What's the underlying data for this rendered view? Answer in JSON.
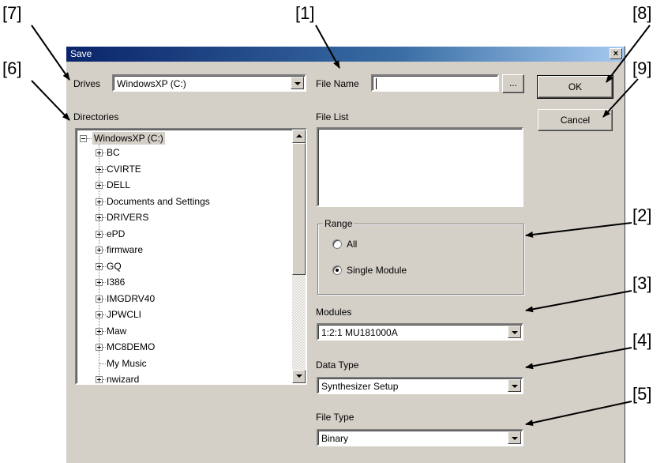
{
  "callouts": [
    "[7]",
    "[1]",
    "[8]",
    "[6]",
    "[9]",
    "[2]",
    "[3]",
    "[4]",
    "[5]"
  ],
  "dialog": {
    "title": "Save",
    "close_glyph": "×"
  },
  "drives": {
    "label": "Drives",
    "value": "WindowsXP (C:)"
  },
  "directories": {
    "label": "Directories",
    "root": "WindowsXP (C:)",
    "items": [
      "BC",
      "CVIRTE",
      "DELL",
      "Documents and Settings",
      "DRIVERS",
      "ePD",
      "firmware",
      "GQ",
      "I386",
      "IMGDRV40",
      "JPWCLI",
      "Maw",
      "MC8DEMO",
      "My Music",
      "nwizard"
    ]
  },
  "file_name": {
    "label": "File Name",
    "value": "",
    "browse_label": "..."
  },
  "file_list": {
    "label": "File List"
  },
  "range": {
    "label": "Range",
    "options": [
      "All",
      "Single Module"
    ],
    "selected": "Single Module"
  },
  "modules": {
    "label": "Modules",
    "value": "1:2:1 MU181000A"
  },
  "data_type": {
    "label": "Data Type",
    "value": "Synthesizer Setup"
  },
  "file_type": {
    "label": "File Type",
    "value": "Binary"
  },
  "buttons": {
    "ok": "OK",
    "cancel": "Cancel"
  },
  "icons": {
    "close": "close-icon",
    "dropdown": "chevron-down-icon",
    "scroll_up": "arrow-up-icon",
    "scroll_down": "arrow-down-icon"
  }
}
